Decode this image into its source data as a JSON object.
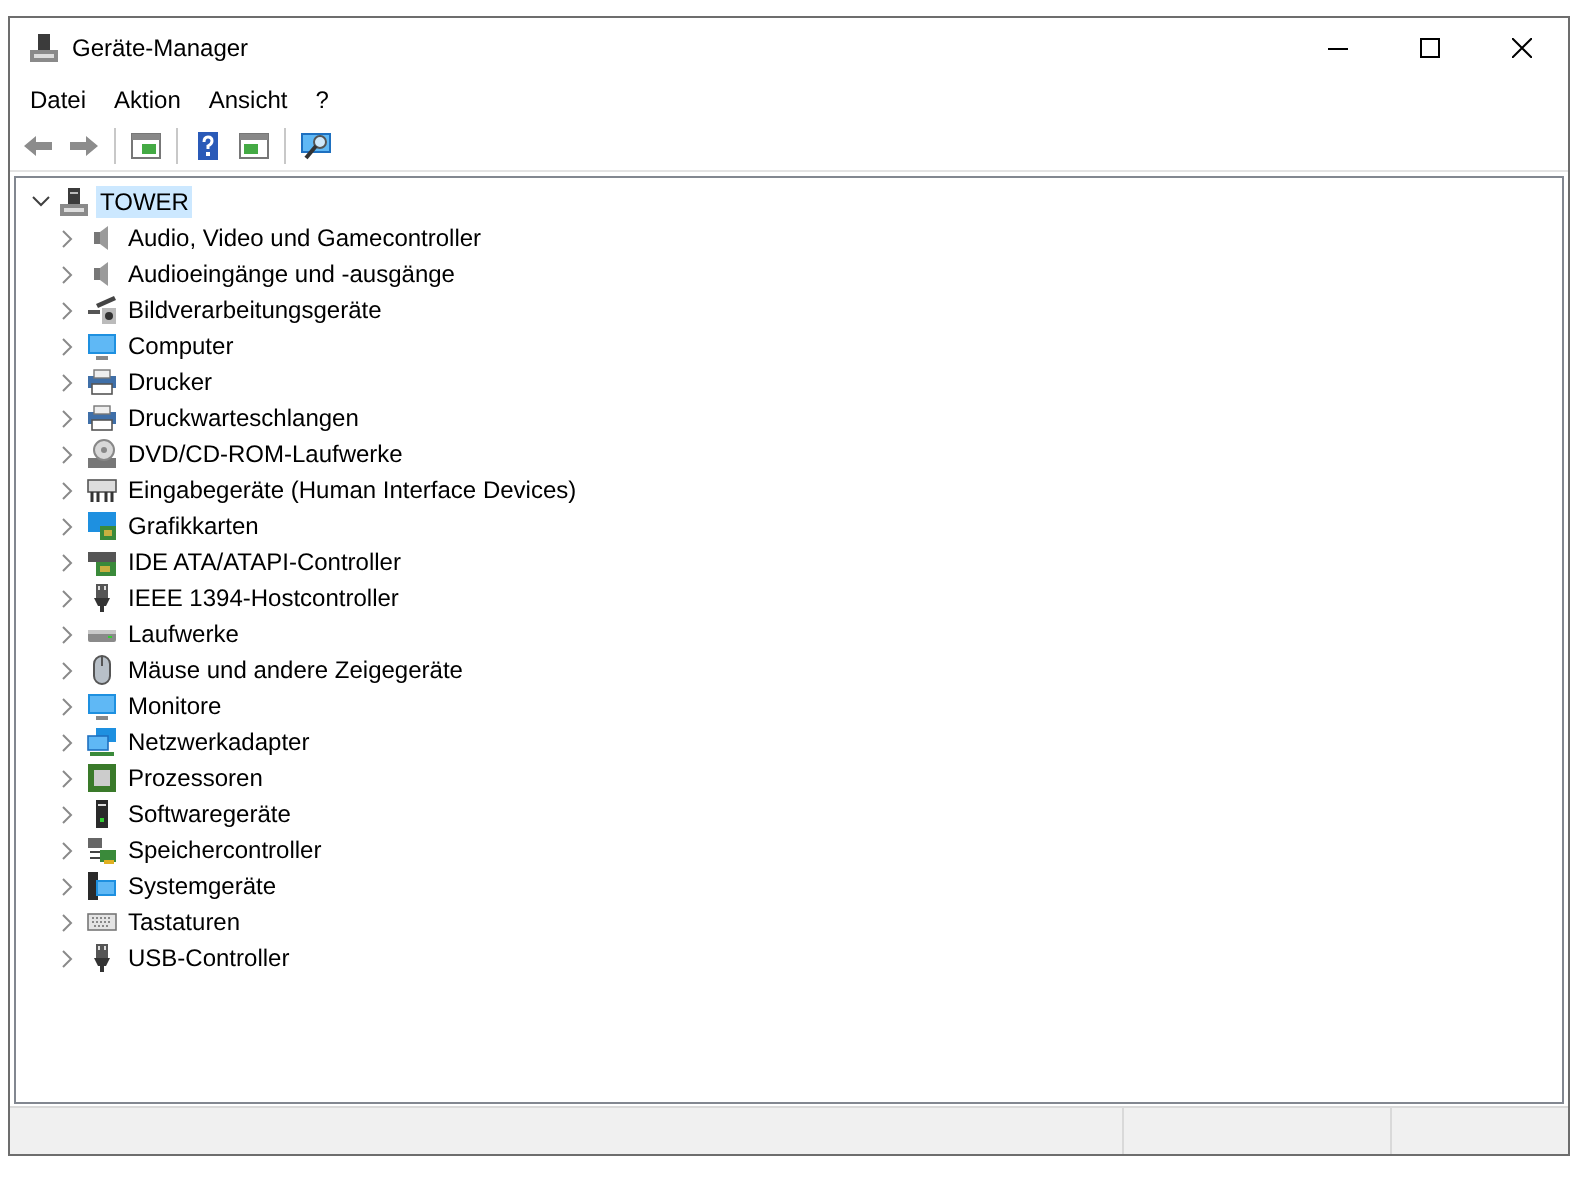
{
  "window": {
    "title": "Geräte-Manager"
  },
  "menu": [
    "Datei",
    "Aktion",
    "Ansicht",
    "?"
  ],
  "tree": {
    "label": "TOWER",
    "kind": "computer-tower",
    "expanded": true,
    "selected": true,
    "children": [
      {
        "label": "Audio, Video und Gamecontroller",
        "kind": "speaker",
        "expanded": false,
        "selected": false
      },
      {
        "label": "Audioeingänge und -ausgänge",
        "kind": "speaker",
        "expanded": false,
        "selected": false
      },
      {
        "label": "Bildverarbeitungsgeräte",
        "kind": "camera",
        "expanded": false,
        "selected": false
      },
      {
        "label": "Computer",
        "kind": "monitor",
        "expanded": false,
        "selected": false
      },
      {
        "label": "Drucker",
        "kind": "printer",
        "expanded": false,
        "selected": false
      },
      {
        "label": "Druckwarteschlangen",
        "kind": "printer",
        "expanded": false,
        "selected": false
      },
      {
        "label": "DVD/CD-ROM-Laufwerke",
        "kind": "disc",
        "expanded": false,
        "selected": false
      },
      {
        "label": "Eingabegeräte (Human Interface Devices)",
        "kind": "input-device",
        "expanded": false,
        "selected": false
      },
      {
        "label": "Grafikkarten",
        "kind": "graphics",
        "expanded": false,
        "selected": false
      },
      {
        "label": "IDE ATA/ATAPI-Controller",
        "kind": "card",
        "expanded": false,
        "selected": false
      },
      {
        "label": "IEEE 1394-Hostcontroller",
        "kind": "plug",
        "expanded": false,
        "selected": false
      },
      {
        "label": "Laufwerke",
        "kind": "drive",
        "expanded": false,
        "selected": false
      },
      {
        "label": "Mäuse und andere Zeigegeräte",
        "kind": "mouse",
        "expanded": false,
        "selected": false
      },
      {
        "label": "Monitore",
        "kind": "monitor",
        "expanded": false,
        "selected": false
      },
      {
        "label": "Netzwerkadapter",
        "kind": "network",
        "expanded": false,
        "selected": false
      },
      {
        "label": "Prozessoren",
        "kind": "chip",
        "expanded": false,
        "selected": false
      },
      {
        "label": "Softwaregeräte",
        "kind": "tower",
        "expanded": false,
        "selected": false
      },
      {
        "label": "Speichercontroller",
        "kind": "storage",
        "expanded": false,
        "selected": false
      },
      {
        "label": "Systemgeräte",
        "kind": "system",
        "expanded": false,
        "selected": false
      },
      {
        "label": "Tastaturen",
        "kind": "keyboard",
        "expanded": false,
        "selected": false
      },
      {
        "label": "USB-Controller",
        "kind": "plug",
        "expanded": false,
        "selected": false
      }
    ]
  }
}
